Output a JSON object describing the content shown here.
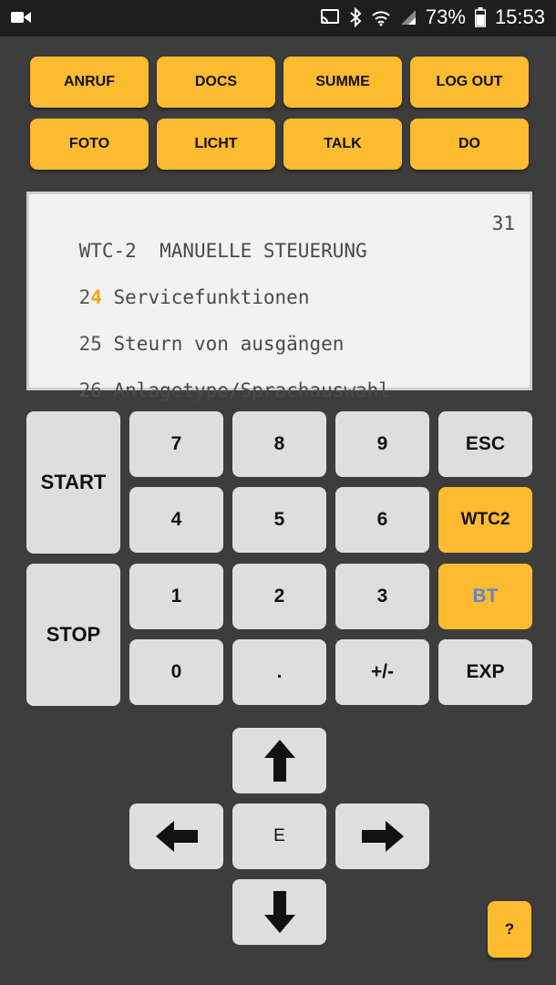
{
  "status_bar": {
    "battery": "73%",
    "time": "15:53"
  },
  "top_buttons": {
    "row1": [
      "ANRUF",
      "DOCS",
      "SUMME",
      "LOG OUT"
    ],
    "row2": [
      "FOTO",
      "LICHT",
      "TALK",
      "DO"
    ]
  },
  "display": {
    "header_left": "WTC-2  MANUELLE STEUERUNG",
    "header_right": "31",
    "lines": [
      {
        "num_a": "2",
        "num_b": "4",
        "text": " Servicefunktionen"
      },
      {
        "num_a": "25",
        "num_b": "",
        "text": " Steurn von ausgängen"
      },
      {
        "num_a": "26",
        "num_b": "",
        "text": " Anlagetype/Sprachauswahl"
      }
    ]
  },
  "keypad": {
    "start": "START",
    "stop": "STOP",
    "keys": [
      "7",
      "8",
      "9",
      "ESC",
      "4",
      "5",
      "6",
      "WTC2",
      "1",
      "2",
      "3",
      "BT",
      "0",
      ".",
      "+/-",
      "EXP"
    ]
  },
  "dpad": {
    "center": "E"
  },
  "help": "?",
  "colors": {
    "accent": "#fdbb30",
    "background": "#3d3d3d",
    "key": "#dedede",
    "bt_text": "#5b87c8"
  }
}
